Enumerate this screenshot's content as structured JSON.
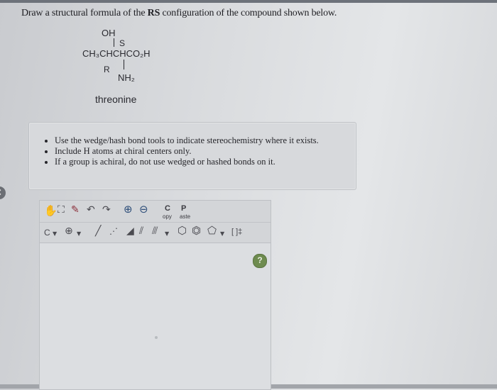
{
  "prompt": {
    "pre": "Draw a structural formula of the ",
    "bold": "RS",
    "post": " configuration of the compound shown below."
  },
  "structure": {
    "oh": "OH",
    "s_label": "S",
    "chain": "CH₃CHCHCO₂H",
    "r_label": "R",
    "nh2": "NH₂",
    "name": "threonine"
  },
  "hints": [
    "Use the wedge/hash bond tools to indicate stereochemistry where it exists.",
    "Include H atoms at chiral centers only.",
    "If a group is achiral, do not use wedged or hashed bonds on it."
  ],
  "toolbar": {
    "copy_big": "C",
    "copy_small": "opy",
    "paste_big": "P",
    "paste_small": "aste",
    "element_select": "C",
    "ring_menu_label": "[ ]‡"
  },
  "help": "?"
}
